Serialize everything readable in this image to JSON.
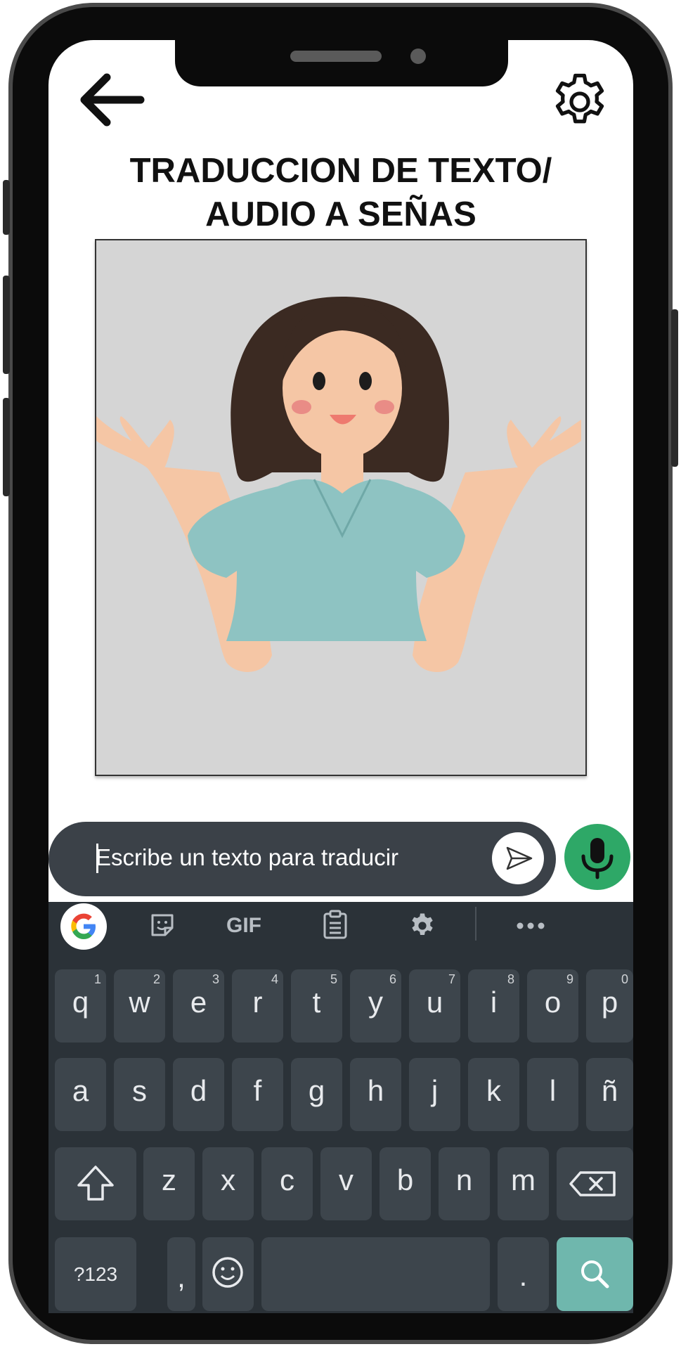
{
  "header": {
    "title_line1": "TRADUCCION DE TEXTO/",
    "title_line2": "AUDIO A SEÑAS"
  },
  "input": {
    "placeholder": "Escribe un texto para traducir"
  },
  "keyboard": {
    "toolbar": [
      "google-icon",
      "sticker-icon",
      "GIF",
      "clipboard-icon",
      "gear-icon",
      "more-icon"
    ],
    "gif_label": "GIF",
    "row1": [
      {
        "key": "q",
        "num": "1"
      },
      {
        "key": "w",
        "num": "2"
      },
      {
        "key": "e",
        "num": "3"
      },
      {
        "key": "r",
        "num": "4"
      },
      {
        "key": "t",
        "num": "5"
      },
      {
        "key": "y",
        "num": "6"
      },
      {
        "key": "u",
        "num": "7"
      },
      {
        "key": "i",
        "num": "8"
      },
      {
        "key": "o",
        "num": "9"
      },
      {
        "key": "p",
        "num": "0"
      }
    ],
    "row2": [
      "a",
      "s",
      "d",
      "f",
      "g",
      "h",
      "j",
      "k",
      "l",
      "ñ"
    ],
    "row3": [
      "z",
      "x",
      "c",
      "v",
      "b",
      "n",
      "m"
    ],
    "symbols_label": "?123",
    "comma_label": ",",
    "period_label": "."
  },
  "colors": {
    "mic_button": "#2ea867",
    "keyboard_bg": "#2b3238",
    "key_bg": "#3d454c",
    "search_key": "#6fb7ad",
    "input_bar": "#3b4148",
    "figure_bg": "#d5d5d5",
    "shirt": "#8ec3c2"
  }
}
